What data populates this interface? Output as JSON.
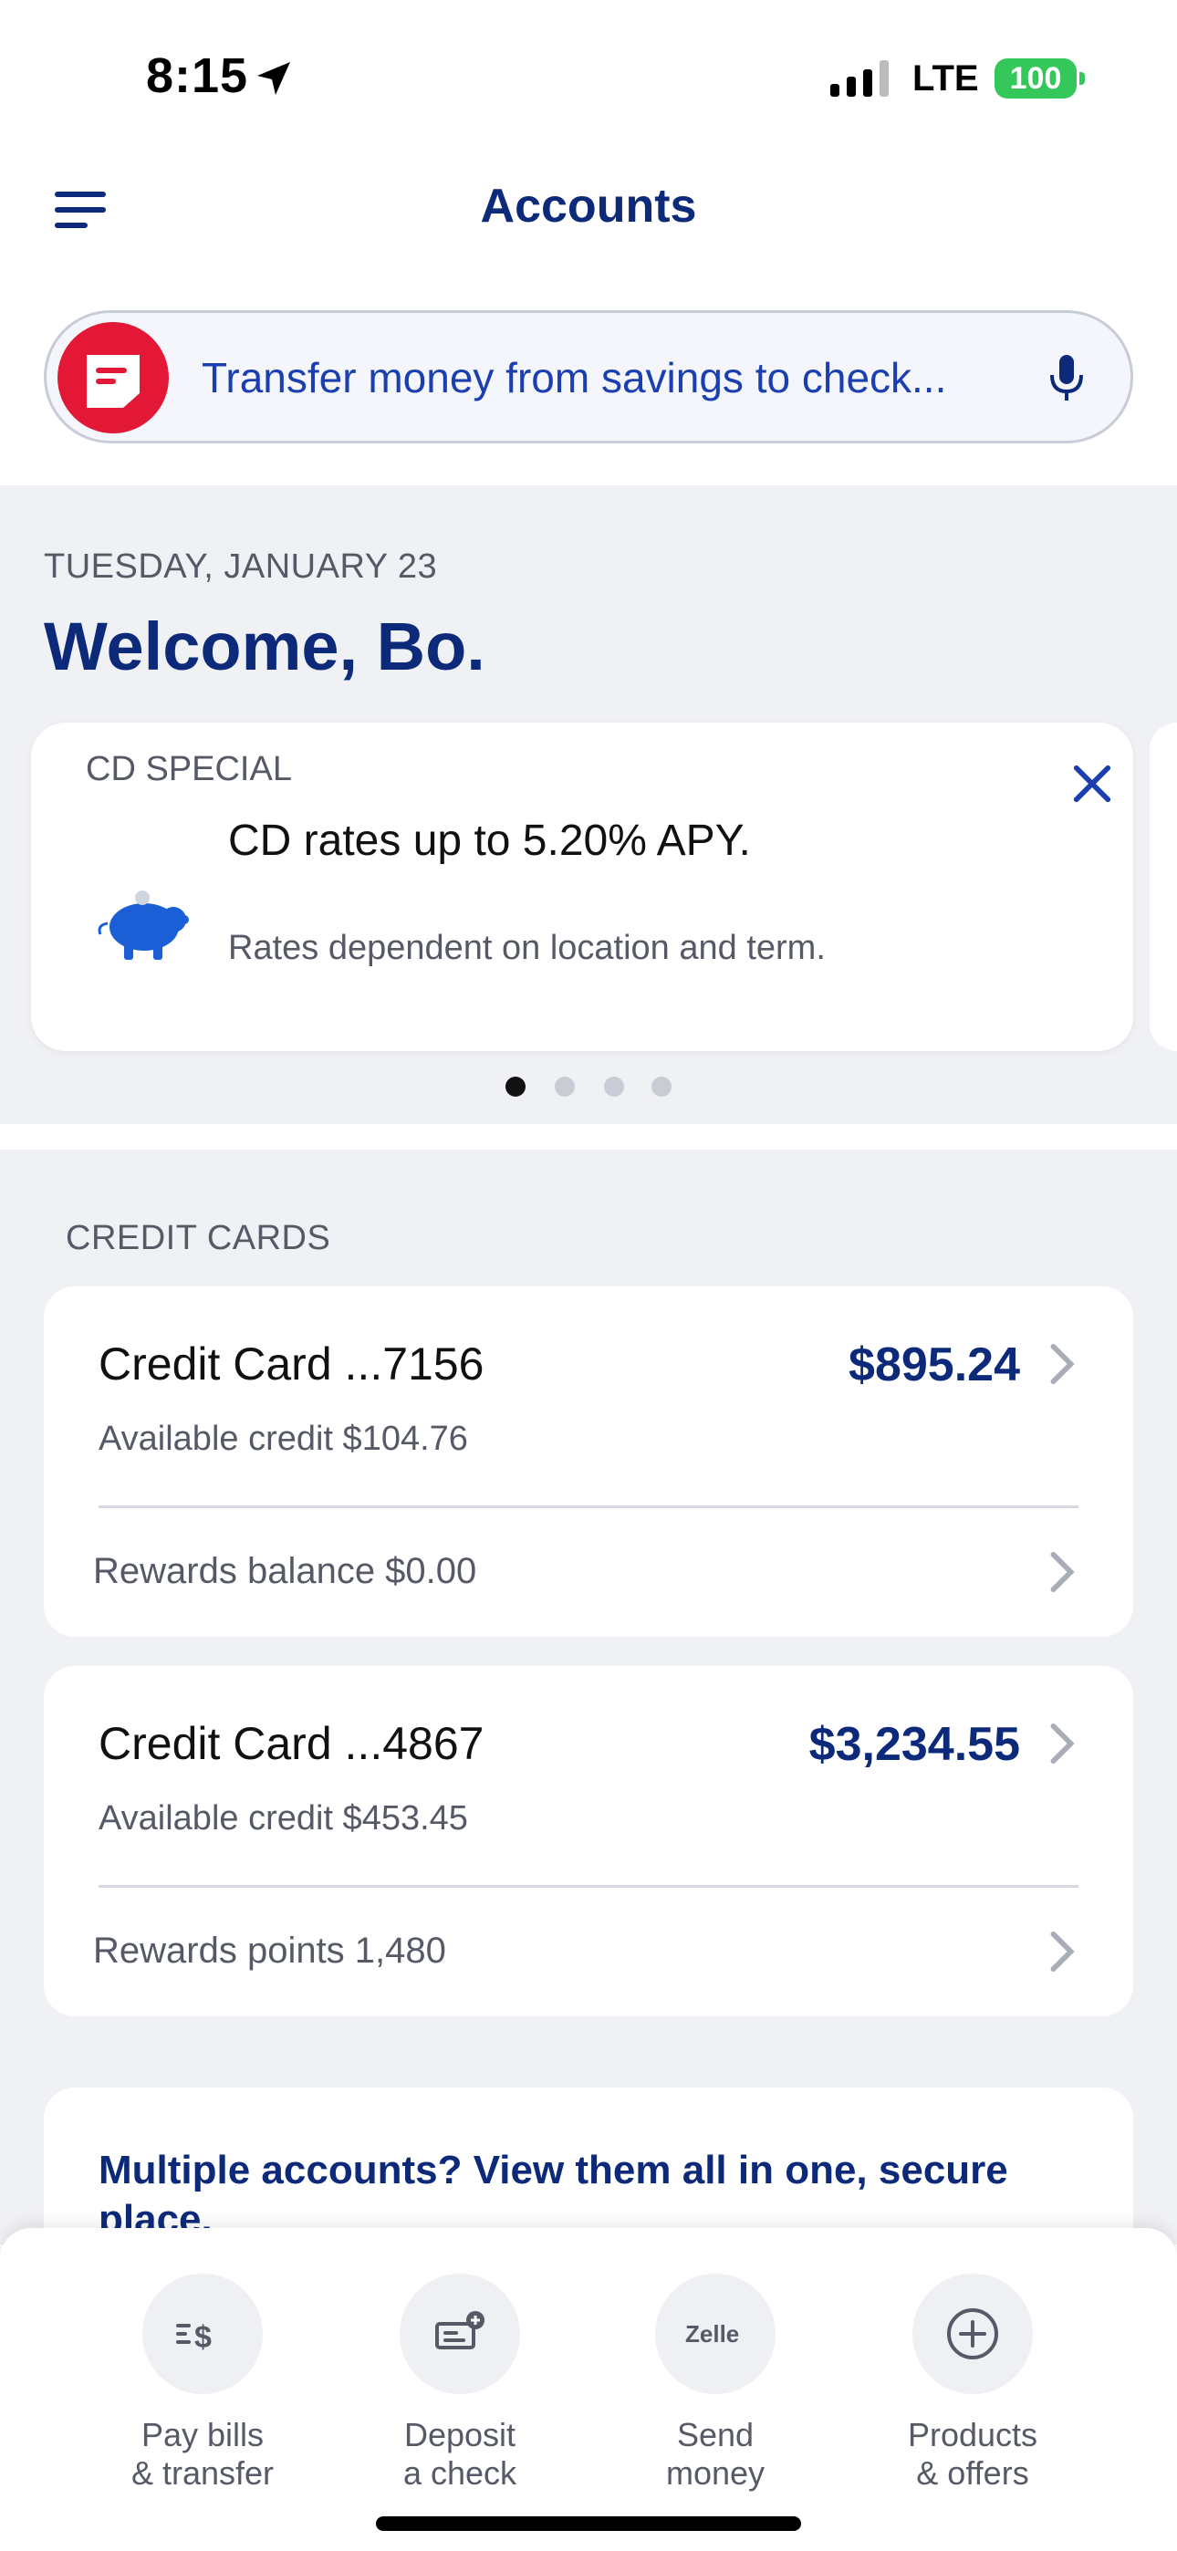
{
  "status_bar": {
    "time": "8:15",
    "network": "LTE",
    "battery": "100",
    "battery_color": "#34c759"
  },
  "header": {
    "title": "Accounts",
    "menu_icon": "hamburger-menu-icon"
  },
  "search": {
    "text": "Transfer money from savings to check...",
    "badge_icon": "erica-chat-icon",
    "mic_icon": "microphone-icon"
  },
  "welcome": {
    "date": "TUESDAY, JANUARY 23",
    "greeting": "Welcome, Bo."
  },
  "promo": {
    "label": "CD SPECIAL",
    "headline": "CD rates up to 5.20% APY.",
    "subtext": "Rates dependent on location and term.",
    "icon": "piggy-bank-icon",
    "page_count": 4,
    "active_page": 1
  },
  "credit_cards": {
    "section_label": "CREDIT CARDS",
    "cards": [
      {
        "name": "Credit Card ...7156",
        "amount": "$895.24",
        "available": "Available credit $104.76",
        "rewards": "Rewards balance $0.00"
      },
      {
        "name": "Credit Card ...4867",
        "amount": "$3,234.55",
        "available": "Available credit $453.45",
        "rewards": "Rewards points 1,480"
      }
    ]
  },
  "promo2": {
    "text": "Multiple accounts? View them all in one, secure place."
  },
  "bottom_nav": {
    "items": [
      {
        "label": "Pay bills\n& transfer",
        "icon": "pay-bills-icon"
      },
      {
        "label": "Deposit\na check",
        "icon": "deposit-check-icon"
      },
      {
        "label": "Send\nmoney",
        "icon": "zelle-icon"
      },
      {
        "label": "Products\n& offers",
        "icon": "plus-circle-icon"
      }
    ]
  },
  "colors": {
    "brand_navy": "#0d2a7a",
    "link_blue": "#1b3fb0",
    "brand_red": "#e31837",
    "page_gray": "#f0f1f4"
  }
}
